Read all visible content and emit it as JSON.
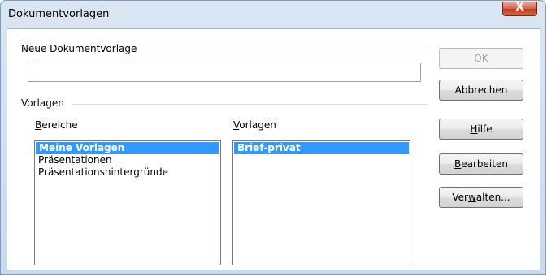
{
  "window": {
    "title": "Dokumentvorlagen",
    "close_symbol": "X"
  },
  "new_template": {
    "group_label": "Neue Dokumentvorlage",
    "value": ""
  },
  "templates_group": {
    "label": "Vorlagen"
  },
  "areas": {
    "label_prefix": "",
    "label_hotkey": "B",
    "label_rest": "ereiche",
    "items": [
      "Meine Vorlagen",
      "Präsentationen",
      "Präsentationshintergründe"
    ],
    "selected": "Meine Vorlagen"
  },
  "templates": {
    "label_hotkey": "V",
    "label_rest": "orlagen",
    "items": [
      "Brief-privat"
    ],
    "selected": "Brief-privat"
  },
  "buttons": {
    "ok": "OK",
    "cancel": "Abbrechen",
    "help_hotkey": "H",
    "help_rest": "ilfe",
    "edit_hotkey": "B",
    "edit_rest": "earbeiten",
    "manage_pre": "Ver",
    "manage_hotkey": "w",
    "manage_rest": "alten..."
  }
}
